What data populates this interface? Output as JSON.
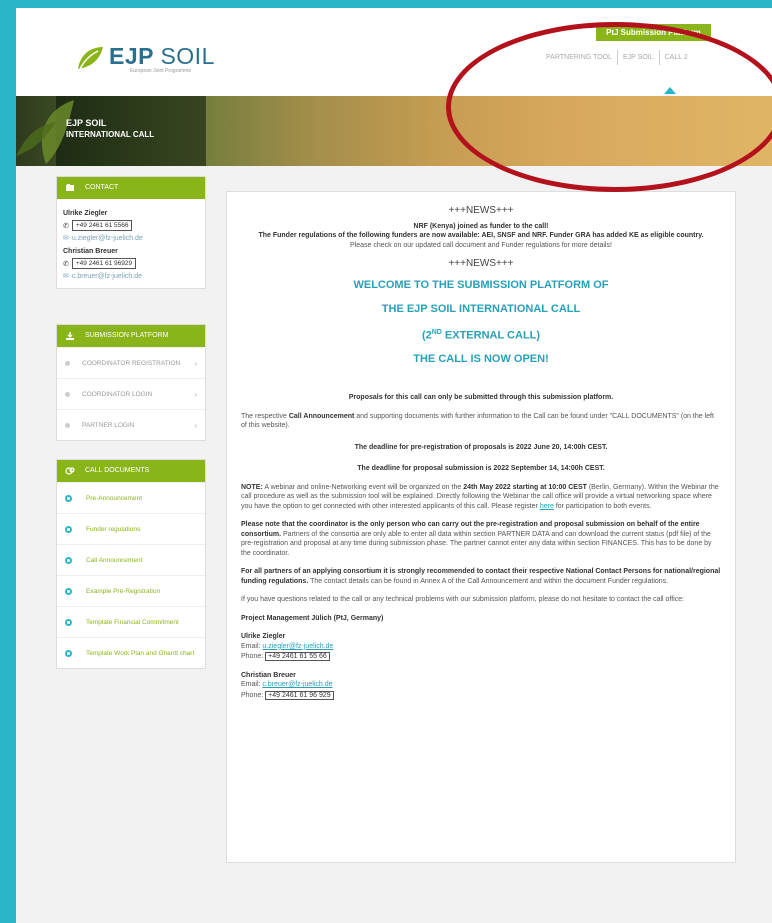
{
  "header": {
    "platform_tab": "PtJ Submission Platform",
    "logo_main": "EJP",
    "logo_soil": "SOIL",
    "logo_sub": "European Joint Programme",
    "nav": [
      "PARTNERING TOOL",
      "EJP SOIL",
      "CALL 2"
    ]
  },
  "banner": {
    "title_line1": "EJP SOIL",
    "title_line2": "INTERNATIONAL CALL"
  },
  "sidebar": {
    "contact": {
      "heading": "CONTACT",
      "people": [
        {
          "name": "Ulrike Ziegler",
          "phone": "+49 2461 61 5566",
          "email": "u.ziegler@fz-juelich.de"
        },
        {
          "name": "Christian Breuer",
          "phone": "+49 2461 61 96929",
          "email": "c.breuer@fz-juelich.de"
        }
      ]
    },
    "submission": {
      "heading": "SUBMISSION PLATFORM",
      "items": [
        "COORDINATOR REGISTRATION",
        "COORDINATOR LOGIN",
        "PARTNER LOGIN"
      ]
    },
    "documents": {
      "heading": "CALL DOCUMENTS",
      "items": [
        "Pre-Announcement",
        "Funder regulations",
        "Call Announcement",
        "Example Pre-Registration",
        "Template Financial Commitment",
        "Template Work Plan and Ghantt chart"
      ]
    }
  },
  "main": {
    "news1": "+++NEWS+++",
    "news_text1": "NRF (Kenya) joined as funder to the call!",
    "news_text2": "The Funder regulations of the following funders are now available: AEI, SNSF and NRF. Funder GRA has added KE as eligible country.",
    "news_text3": "Please check on our updated call document and Funder regulations for more details!",
    "news2": "+++NEWS+++",
    "welcome1": "WELCOME TO THE SUBMISSION PLATFORM OF",
    "welcome2": "THE EJP SOIL INTERNATIONAL CALL",
    "welcome3a": "(2",
    "welcome3sup": "ND",
    "welcome3b": " EXTERNAL CALL)",
    "welcome4": "THE CALL IS NOW OPEN!",
    "proposals": "Proposals for this call can only be submitted through this submission platform.",
    "p1a": "The respective ",
    "p1b": "Call Announcement",
    "p1c": " and supporting documents with further information to the Call can be found under \"CALL DOCUMENTS\" (on the left of this website).",
    "deadline1": "The deadline for pre-registration of proposals is 2022 June 20, 14:00h CEST.",
    "deadline2": "The deadline for proposal submission is 2022 September 14, 14:00h CEST.",
    "note_label": "NOTE:",
    "note_a": " A webinar and online-Networking event will be organized on the ",
    "note_b": "24th May 2022 starting at 10:00 CEST",
    "note_c": " (Berlin, Germany). Within the Webinar the call procedure as well as the submission tool will be explained. Directly following the Webinar the call office will provide a virtual networking space where you have the option to get connected with other interested applicants of this call. Please register ",
    "note_link": "here",
    "note_d": " for participation to both events.",
    "coord_bold": "Please note that the coordinator is the only person who can carry out the pre-registration and proposal submission on behalf of the entire consortium.",
    "coord_rest": " Partners of the consortia are only able to enter all data within section PARTNER DATA and can download the current status (pdf file) of the pre-registration and proposal at any time during submission phase. The partner cannot enter any data within section FINANCES. This has to be done by the coordinator.",
    "partners_bold": "For all partners of an applying consortium it is strongly recommended to contact their respective National Contact Persons for national/regional funding regulations.",
    "partners_rest": " The contact details can be found in Annex A of the Call Announcement and within the document Funder regulations.",
    "questions": "If you have questions related to the call or any technical problems with our submission platform, please do not hesitate to contact the call office:",
    "org": "Project Management Jülich (PtJ, Germany)",
    "contact1_name": "Ulrike Ziegler",
    "contact1_email_label": "Email: ",
    "contact1_email": "u.ziegler@fz-juelich.de",
    "contact1_phone_label": "Phone: ",
    "contact1_phone": "+49 2461 61 55 66",
    "contact2_name": "Christian Breuer",
    "contact2_email_label": "Email: ",
    "contact2_email": "c.breuer@fz-juelich.de",
    "contact2_phone_label": "Phone: ",
    "contact2_phone": "+49 2461 61 96 929"
  },
  "colors": {
    "accent_green": "#8ab51a",
    "accent_teal": "#29b6c8",
    "highlight_oval": "#b3121d"
  }
}
